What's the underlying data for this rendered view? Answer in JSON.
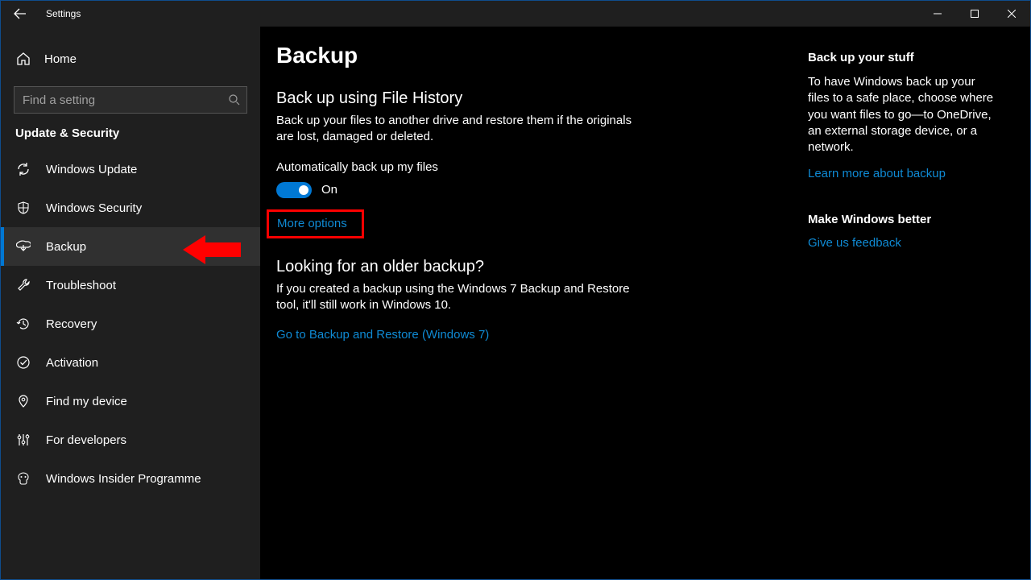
{
  "titlebar": {
    "title": "Settings"
  },
  "sidebar": {
    "home": "Home",
    "search_placeholder": "Find a setting",
    "section": "Update & Security",
    "items": [
      {
        "label": "Windows Update"
      },
      {
        "label": "Windows Security"
      },
      {
        "label": "Backup"
      },
      {
        "label": "Troubleshoot"
      },
      {
        "label": "Recovery"
      },
      {
        "label": "Activation"
      },
      {
        "label": "Find my device"
      },
      {
        "label": "For developers"
      },
      {
        "label": "Windows Insider Programme"
      }
    ]
  },
  "main": {
    "title": "Backup",
    "fh_heading": "Back up using File History",
    "fh_desc": "Back up your files to another drive and restore them if the originals are lost, damaged or deleted.",
    "auto_label": "Automatically back up my files",
    "toggle_state": "On",
    "more_options": "More options",
    "older_heading": "Looking for an older backup?",
    "older_desc": "If you created a backup using the Windows 7 Backup and Restore tool, it'll still work in Windows 10.",
    "older_link": "Go to Backup and Restore (Windows 7)"
  },
  "right": {
    "h1": "Back up your stuff",
    "d1": "To have Windows back up your files to a safe place, choose where you want files to go—to OneDrive, an external storage device, or a network.",
    "l1": "Learn more about backup",
    "h2": "Make Windows better",
    "l2": "Give us feedback"
  }
}
